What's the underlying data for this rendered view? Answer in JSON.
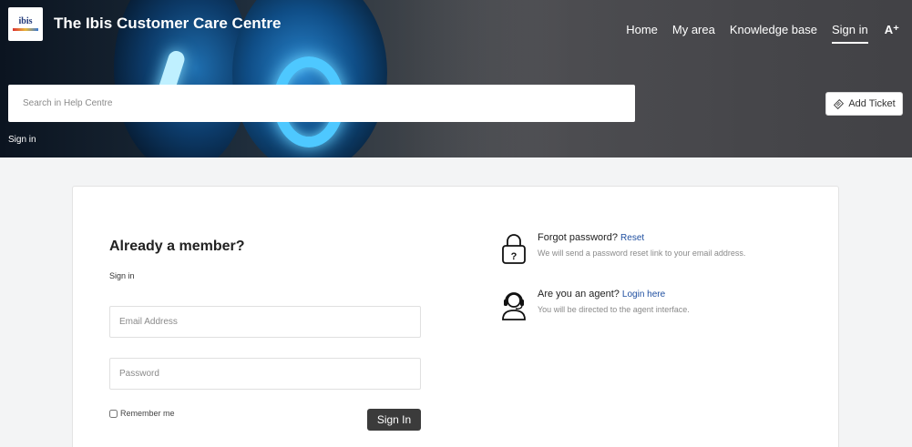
{
  "header": {
    "logo_text": "ibis",
    "title": "The Ibis Customer Care Centre",
    "nav": [
      {
        "label": "Home"
      },
      {
        "label": "My area"
      },
      {
        "label": "Knowledge base"
      },
      {
        "label": "Sign in",
        "active": true
      }
    ],
    "font_toggle": "A⁺",
    "search_placeholder": "Search in Help Centre",
    "add_ticket_label": "Add Ticket",
    "breadcrumb": "Sign in"
  },
  "login": {
    "heading": "Already a member?",
    "subheading": "Sign in",
    "email_placeholder": "Email Address",
    "password_placeholder": "Password",
    "remember_label": "Remember me",
    "submit_label": "Sign In"
  },
  "help": {
    "forgot_title": "Forgot password?",
    "forgot_link": "Reset",
    "forgot_desc": "We will send a password reset link to your email address.",
    "agent_title": "Are you an agent?",
    "agent_link": "Login here",
    "agent_desc": "You will be directed to the agent interface."
  },
  "icons": {
    "logo": "ibis-logo",
    "add_ticket": "ticket-icon",
    "lock": "lock-question-icon",
    "agent": "headset-agent-icon"
  },
  "colors": {
    "primary_button": "#3b3b3b",
    "link": "#1f4fa0",
    "page_background": "#f3f4f5"
  }
}
